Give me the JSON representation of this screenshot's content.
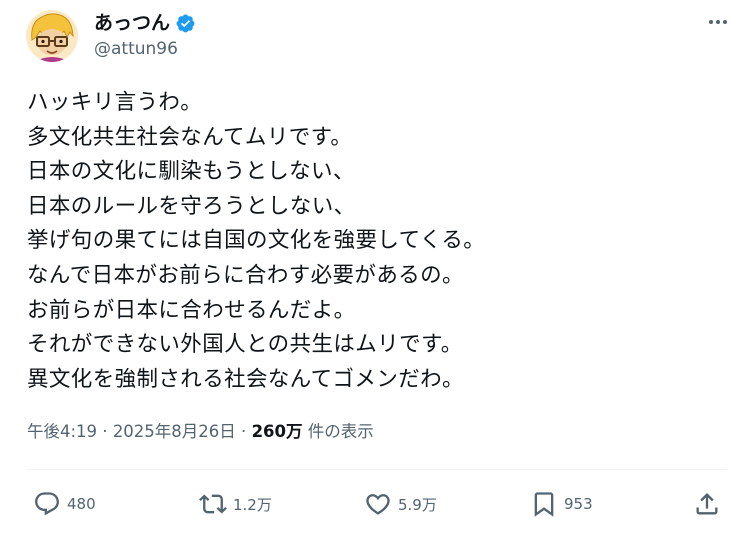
{
  "author": {
    "display_name": "あっつん",
    "handle": "@attun96",
    "verified": true,
    "avatar_icon": "cartoon-avatar-icon"
  },
  "tweet": {
    "lines": [
      "ハッキリ言うわ。",
      "多文化共生社会なんてムリです。",
      "日本の文化に馴染もうとしない、",
      "日本のルールを守ろうとしない、",
      "挙げ句の果てには自国の文化を強要してくる。",
      "なんで日本がお前らに合わす必要があるの。",
      "お前らが日本に合わせるんだよ。",
      "それができない外国人との共生はムリです。",
      "異文化を強制される社会なんてゴメンだわ。"
    ]
  },
  "meta": {
    "time": "午後4:19",
    "sep1": " · ",
    "date": "2025年8月26日",
    "sep2": " · ",
    "views_count": "260万",
    "views_suffix": " 件の表示"
  },
  "actions": {
    "reply_count": "480",
    "retweet_count": "1.2万",
    "like_count": "5.9万",
    "bookmark_count": "953"
  },
  "colors": {
    "text": "#0f1419",
    "secondary": "#536471",
    "verified_blue": "#1d9bf0",
    "divider": "#eff3f4"
  }
}
